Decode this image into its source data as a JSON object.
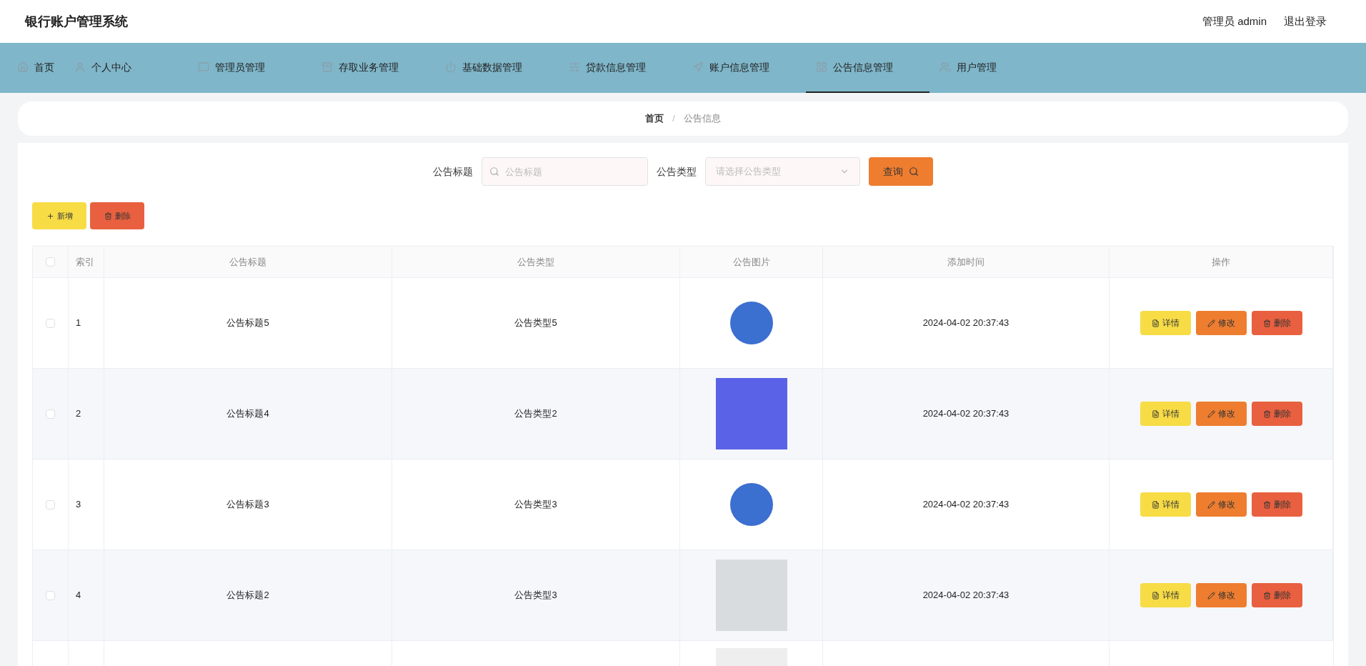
{
  "app_title": "银行账户管理系统",
  "user_menu": {
    "user": "管理员 admin",
    "logout": "退出登录"
  },
  "nav": [
    {
      "label": "首页",
      "selected": false
    },
    {
      "label": "个人中心",
      "selected": false
    },
    {
      "label": "管理员管理",
      "selected": false
    },
    {
      "label": "存取业务管理",
      "selected": false
    },
    {
      "label": "基础数据管理",
      "selected": false
    },
    {
      "label": "贷款信息管理",
      "selected": false
    },
    {
      "label": "账户信息管理",
      "selected": false
    },
    {
      "label": "公告信息管理",
      "selected": true
    },
    {
      "label": "用户管理",
      "selected": false
    }
  ],
  "breadcrumb": {
    "separator": "/",
    "items": [
      {
        "label": "首页",
        "current": false
      },
      {
        "label": "公告信息",
        "current": true
      }
    ]
  },
  "search": {
    "fields": [
      {
        "kind": "text",
        "label": "公告标题",
        "placeholder": "公告标题"
      },
      {
        "kind": "select",
        "label": "公告类型",
        "placeholder": "请选择公告类型"
      }
    ],
    "button": "查询"
  },
  "toolbar": [
    {
      "kind": "add",
      "label": "新增"
    },
    {
      "kind": "delete",
      "label": "删除"
    }
  ],
  "table": {
    "select_all": {
      "checked": false
    },
    "columns": [
      "索引",
      "公告标题",
      "公告类型",
      "公告图片",
      "添加时间",
      "操作"
    ],
    "rows": [
      {
        "checked": false,
        "index": "1",
        "title": "公告标题5",
        "type": "公告类型5",
        "time": "2024-04-02 20:37:43",
        "actions": [
          {
            "kind": "detail",
            "label": "详情"
          },
          {
            "kind": "edit",
            "label": "修改"
          },
          {
            "kind": "delete",
            "label": "删除"
          }
        ]
      },
      {
        "checked": false,
        "index": "2",
        "title": "公告标题4",
        "type": "公告类型2",
        "time": "2024-04-02 20:37:43",
        "actions": [
          {
            "kind": "detail",
            "label": "详情"
          },
          {
            "kind": "edit",
            "label": "修改"
          },
          {
            "kind": "delete",
            "label": "删除"
          }
        ]
      },
      {
        "checked": false,
        "index": "3",
        "title": "公告标题3",
        "type": "公告类型3",
        "time": "2024-04-02 20:37:43",
        "actions": [
          {
            "kind": "detail",
            "label": "详情"
          },
          {
            "kind": "edit",
            "label": "修改"
          },
          {
            "kind": "delete",
            "label": "删除"
          }
        ]
      },
      {
        "checked": false,
        "index": "4",
        "title": "公告标题2",
        "type": "公告类型3",
        "time": "2024-04-02 20:37:43",
        "actions": [
          {
            "kind": "detail",
            "label": "详情"
          },
          {
            "kind": "edit",
            "label": "修改"
          },
          {
            "kind": "delete",
            "label": "删除"
          }
        ]
      }
    ]
  }
}
